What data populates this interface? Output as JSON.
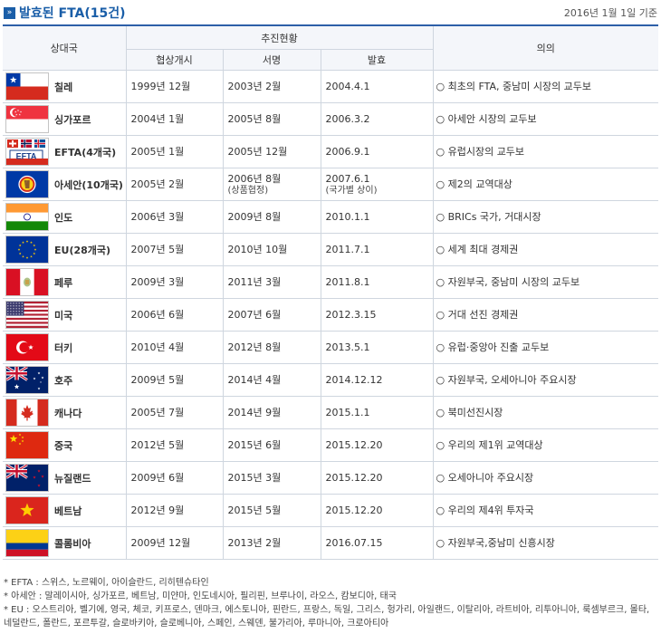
{
  "header": {
    "icon": "»",
    "title": "발효된 FTA(15건)",
    "date_note": "2016년 1월 1일 기준"
  },
  "table": {
    "col_partner": "상대국",
    "col_status": "추진현황",
    "col_start": "협상개시",
    "col_signed": "서명",
    "col_effective": "발효",
    "col_significance": "의의"
  },
  "rows": [
    {
      "flag": "chile-flag",
      "country": "칠레",
      "start": "1999년 12월",
      "signed": "2003년 2월",
      "signed_note": "",
      "effective": "2004.4.1",
      "effective_note": "",
      "significance": "○ 최초의 FTA, 중남미 시장의 교두보"
    },
    {
      "flag": "singapore-flag",
      "country": "싱가포르",
      "start": "2004년 1월",
      "signed": "2005년 8월",
      "signed_note": "",
      "effective": "2006.3.2",
      "effective_note": "",
      "significance": "○ 아세안 시장의 교두보"
    },
    {
      "flag": "efta-flag",
      "country": "EFTA(4개국)",
      "start": "2005년 1월",
      "signed": "2005년 12월",
      "signed_note": "",
      "effective": "2006.9.1",
      "effective_note": "",
      "significance": "○ 유럽시장의 교두보"
    },
    {
      "flag": "asean-flag",
      "country": "아세안(10개국)",
      "start": "2005년 2월",
      "signed": "2006년 8월",
      "signed_note": "(상품협정)",
      "effective": "2007.6.1",
      "effective_note": "(국가별 상이)",
      "significance": "○ 제2의 교역대상"
    },
    {
      "flag": "india-flag",
      "country": "인도",
      "start": "2006년 3월",
      "signed": "2009년 8월",
      "signed_note": "",
      "effective": "2010.1.1",
      "effective_note": "",
      "significance": "○ BRICs 국가, 거대시장"
    },
    {
      "flag": "eu-flag",
      "country": "EU(28개국)",
      "start": "2007년 5월",
      "signed": "2010년 10월",
      "signed_note": "",
      "effective": "2011.7.1",
      "effective_note": "",
      "significance": "○ 세계 최대 경제권"
    },
    {
      "flag": "peru-flag",
      "country": "페루",
      "start": "2009년 3월",
      "signed": "2011년 3월",
      "signed_note": "",
      "effective": "2011.8.1",
      "effective_note": "",
      "significance": "○ 자원부국, 중남미 시장의 교두보"
    },
    {
      "flag": "usa-flag",
      "country": "미국",
      "start": "2006년 6월",
      "signed": "2007년 6월",
      "signed_note": "",
      "effective": "2012.3.15",
      "effective_note": "",
      "significance": "○ 거대 선진 경제권"
    },
    {
      "flag": "turkey-flag",
      "country": "터키",
      "start": "2010년 4월",
      "signed": "2012년 8월",
      "signed_note": "",
      "effective": "2013.5.1",
      "effective_note": "",
      "significance": "○ 유럽·중앙아 진출 교두보"
    },
    {
      "flag": "australia-flag",
      "country": "호주",
      "start": "2009년 5월",
      "signed": "2014년 4월",
      "signed_note": "",
      "effective": "2014.12.12",
      "effective_note": "",
      "significance": "○ 자원부국, 오세아니아 주요시장"
    },
    {
      "flag": "canada-flag",
      "country": "캐나다",
      "start": "2005년 7월",
      "signed": "2014년 9월",
      "signed_note": "",
      "effective": "2015.1.1",
      "effective_note": "",
      "significance": "○ 북미선진시장"
    },
    {
      "flag": "china-flag",
      "country": "중국",
      "start": "2012년 5월",
      "signed": "2015년 6월",
      "signed_note": "",
      "effective": "2015.12.20",
      "effective_note": "",
      "significance": "○ 우리의 제1위 교역대상"
    },
    {
      "flag": "new-zealand-flag",
      "country": "뉴질랜드",
      "start": "2009년 6월",
      "signed": "2015년 3월",
      "signed_note": "",
      "effective": "2015.12.20",
      "effective_note": "",
      "significance": "○ 오세아니아 주요시장"
    },
    {
      "flag": "vietnam-flag",
      "country": "베트남",
      "start": "2012년 9월",
      "signed": "2015년 5월",
      "signed_note": "",
      "effective": "2015.12.20",
      "effective_note": "",
      "significance": "○ 우리의 제4위 투자국"
    },
    {
      "flag": "colombia-flag",
      "country": "콜롬비아",
      "start": "2009년 12월",
      "signed": "2013년 2월",
      "signed_note": "",
      "effective": "2016.07.15",
      "effective_note": "",
      "significance": "○ 자원부국,중남미 신흥시장"
    }
  ],
  "notes": {
    "efta": "* EFTA : 스위스, 노르웨이, 아이슬란드, 리히텐슈타인",
    "asean": "* 아세안 : 말레이시아, 싱가포르, 베트남, 미얀마, 인도네시아, 필리핀, 브루나이, 라오스, 캄보디아, 태국",
    "eu": "* EU : 오스트리아, 벨기에, 영국, 체코, 키프로스, 덴마크, 에스토니아, 핀란드, 프랑스, 독일, 그리스, 헝가리, 아일랜드, 이탈리아, 라트비아, 리투아니아, 룩셈부르크, 몰타, 네덜란드, 폴란드, 포르투갈, 슬로바키아, 슬로베니아, 스페인, 스웨덴, 불가리아, 루마니아, 크로아티아"
  },
  "flag_badge": "EFTA",
  "colors": {
    "accent": "#1a5ea8",
    "header_bg": "#f4f6fa",
    "border": "#cfd6df"
  }
}
